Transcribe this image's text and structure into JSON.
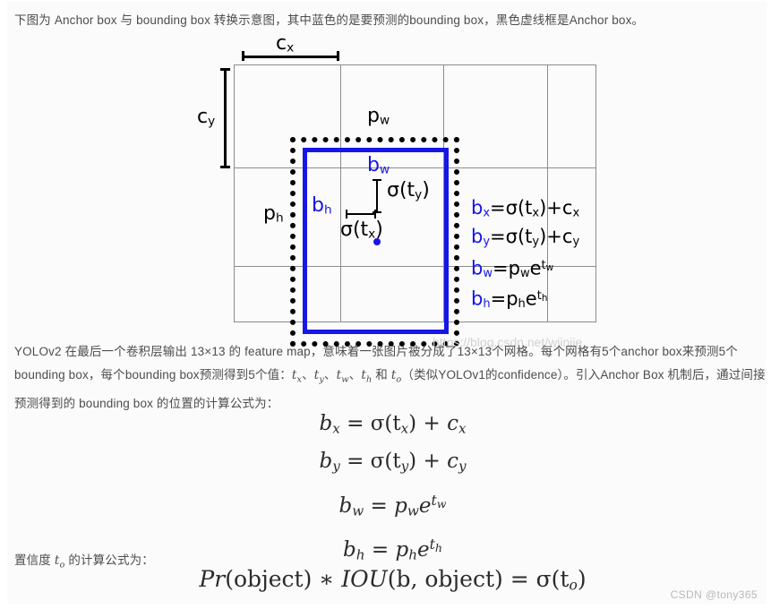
{
  "intro": {
    "text": "下图为 Anchor box 与 bounding box 转换示意图，其中蓝色的是要预测的bounding box，黑色虚线框是Anchor box。"
  },
  "diagram": {
    "labels": {
      "cx": "c",
      "cx_sub": "x",
      "cy": "c",
      "cy_sub": "y",
      "pw": "p",
      "pw_sub": "w",
      "ph": "p",
      "ph_sub": "h",
      "bw": "b",
      "bw_sub": "w",
      "bh": "b",
      "bh_sub": "h",
      "sigma_tx": "σ(t",
      "sigma_tx_sub": "x",
      "sigma_tx_end": ")",
      "sigma_ty": "σ(t",
      "sigma_ty_sub": "y",
      "sigma_ty_end": ")"
    },
    "equations": [
      {
        "lhs": "b",
        "lhs_sub": "x",
        "rhs": "=σ(t",
        "rhs_sub": "x",
        "rhs_tail": ")+c",
        "tail_sub": "x"
      },
      {
        "lhs": "b",
        "lhs_sub": "y",
        "rhs": "=σ(t",
        "rhs_sub": "y",
        "rhs_tail": ")+c",
        "tail_sub": "y"
      },
      {
        "lhs": "b",
        "lhs_sub": "w",
        "rhs": "=p",
        "rhs_sub": "w",
        "rhs_tail": "e",
        "sup": "t",
        "sup_sub": "w"
      },
      {
        "lhs": "b",
        "lhs_sub": "h",
        "rhs": "=p",
        "rhs_sub": "h",
        "rhs_tail": "e",
        "sup": "t",
        "sup_sub": "h"
      }
    ],
    "watermark": "https://blog.csdn.net/wjinjie",
    "colors": {
      "bbox_blue": "#1616E8",
      "anchor_black": "#000000",
      "grid_gray": "#8C8C8C"
    }
  },
  "body": {
    "segments": [
      {
        "t": "YOLOv2 在最后一个卷积层输出 13×13 的 feature map，意味着一张图片被分成了13×13个网格。每个网格有5个anchor box来预测5个bounding box，每个bounding box预测得到5个值："
      },
      {
        "t": "tx",
        "math": true
      },
      {
        "t": "、"
      },
      {
        "t": "ty",
        "math": true
      },
      {
        "t": "、"
      },
      {
        "t": "tw",
        "math": true
      },
      {
        "t": "、"
      },
      {
        "t": "th",
        "math": true
      },
      {
        "t": " 和 "
      },
      {
        "t": "to",
        "math": true
      },
      {
        "t": "（类似YOLOv1的confidence）。引入Anchor Box 机制后，通过间接预测得到的 bounding box 的位置的计算公式为："
      }
    ],
    "math_tokens": {
      "tx": "t",
      "tx_sub": "x",
      "ty": "t",
      "ty_sub": "y",
      "tw": "t",
      "tw_sub": "w",
      "th": "t",
      "th_sub": "h",
      "to": "t",
      "to_sub": "o"
    }
  },
  "formulas": {
    "rows": [
      {
        "lhs": "b",
        "lhs_sub": "x",
        "eq": "=",
        "fn": "σ(t",
        "fn_sub": "x",
        "fn_end": ")",
        "plus": "+",
        "term": "c",
        "term_sub": "x"
      },
      {
        "lhs": "b",
        "lhs_sub": "y",
        "eq": "=",
        "fn": "σ(t",
        "fn_sub": "y",
        "fn_end": ")",
        "plus": "+",
        "term": "c",
        "term_sub": "y"
      },
      {
        "lhs": "b",
        "lhs_sub": "w",
        "eq": "=",
        "base": "p",
        "base_sub": "w",
        "exp_base": "e",
        "exp": "t",
        "exp_sub": "w"
      },
      {
        "lhs": "b",
        "lhs_sub": "h",
        "eq": "=",
        "base": "p",
        "base_sub": "h",
        "exp_base": "e",
        "exp": "t",
        "exp_sub": "h"
      }
    ]
  },
  "confidence": {
    "lead_1": "置信度 ",
    "lead_math": "t",
    "lead_math_sub": "o",
    "lead_2": " 的计算公式为：",
    "formula": {
      "pr": "Pr",
      "obj_open": "(object)",
      "star": " ∗ ",
      "iou": "IOU",
      "iou_args": "(b, object)",
      "eq": " = ",
      "sigma": "σ(t",
      "sigma_sub": "o",
      "sigma_end": ")"
    }
  },
  "watermarks": {
    "bottom": "CSDN @tony365"
  }
}
